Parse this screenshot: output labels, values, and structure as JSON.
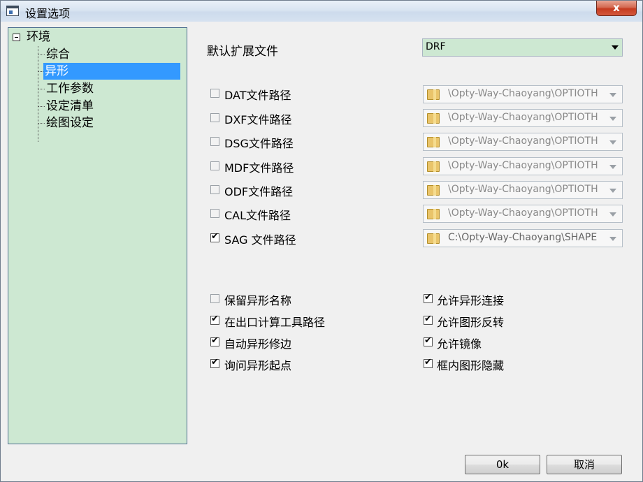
{
  "window": {
    "title": "设置选项",
    "close_label": "x"
  },
  "tree": {
    "root": "环境",
    "items": [
      "综合",
      "异形",
      "工作参数",
      "设定清单",
      "绘图设定"
    ],
    "selected_index": 1
  },
  "default_ext": {
    "label": "默认扩展文件",
    "value": "DRF"
  },
  "paths": [
    {
      "label": "DAT文件路径",
      "checked": false,
      "value": "\\Opty-Way-Chaoyang\\OPTIOTH"
    },
    {
      "label": "DXF文件路径",
      "checked": false,
      "value": "\\Opty-Way-Chaoyang\\OPTIOTH"
    },
    {
      "label": "DSG文件路径",
      "checked": false,
      "value": "\\Opty-Way-Chaoyang\\OPTIOTH"
    },
    {
      "label": "MDF文件路径",
      "checked": false,
      "value": "\\Opty-Way-Chaoyang\\OPTIOTH"
    },
    {
      "label": "ODF文件路径",
      "checked": false,
      "value": "\\Opty-Way-Chaoyang\\OPTIOTH"
    },
    {
      "label": "CAL文件路径",
      "checked": false,
      "value": "\\Opty-Way-Chaoyang\\OPTIOTH"
    },
    {
      "label": "SAG 文件路径",
      "checked": true,
      "value": "C:\\Opty-Way-Chaoyang\\SHAPE"
    }
  ],
  "options_left": [
    {
      "label": "保留异形名称",
      "checked": false
    },
    {
      "label": "在出口计算工具路径",
      "checked": true
    },
    {
      "label": "自动异形修边",
      "checked": true
    },
    {
      "label": "询问异形起点",
      "checked": true
    }
  ],
  "options_right": [
    {
      "label": "允许异形连接",
      "checked": true
    },
    {
      "label": "允许图形反转",
      "checked": true
    },
    {
      "label": "允许镜像",
      "checked": true
    },
    {
      "label": "框内图形隐藏",
      "checked": true
    }
  ],
  "buttons": {
    "ok": "0k",
    "cancel": "取消"
  },
  "colors": {
    "tree_bg": "#cde8d2",
    "selection": "#3399ff"
  }
}
